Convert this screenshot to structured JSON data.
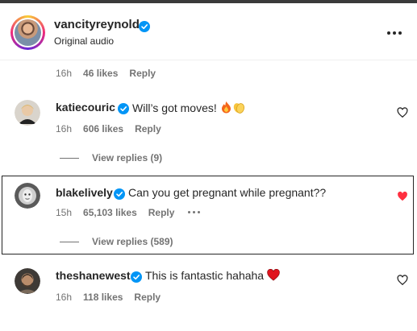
{
  "post": {
    "username": "vancityreynolds",
    "subtitle": "Original audio"
  },
  "first_meta": {
    "time": "16h",
    "likes": "46 likes",
    "reply": "Reply"
  },
  "comments": [
    {
      "username": "katiecouric",
      "text": "Will’s got moves!",
      "emojis": [
        "fire-emoji",
        "clapping-hands-emoji"
      ],
      "time": "16h",
      "likes": "606 likes",
      "reply": "Reply",
      "view_replies": "View replies (9)",
      "liked": false
    },
    {
      "username": "blakelively",
      "text": "Can you get pregnant while pregnant??",
      "time": "15h",
      "likes": "65,103 likes",
      "reply": "Reply",
      "view_replies": "View replies (589)",
      "liked": true
    },
    {
      "username": "theshanewest",
      "text": "This is fantastic hahaha",
      "emojis": [
        "red-heart-emoji"
      ],
      "time": "16h",
      "likes": "118 likes",
      "reply": "Reply",
      "liked": false
    }
  ],
  "colors": {
    "verified": "#0095f6",
    "liked_heart": "#ff3040",
    "secondary_text": "#737373"
  }
}
